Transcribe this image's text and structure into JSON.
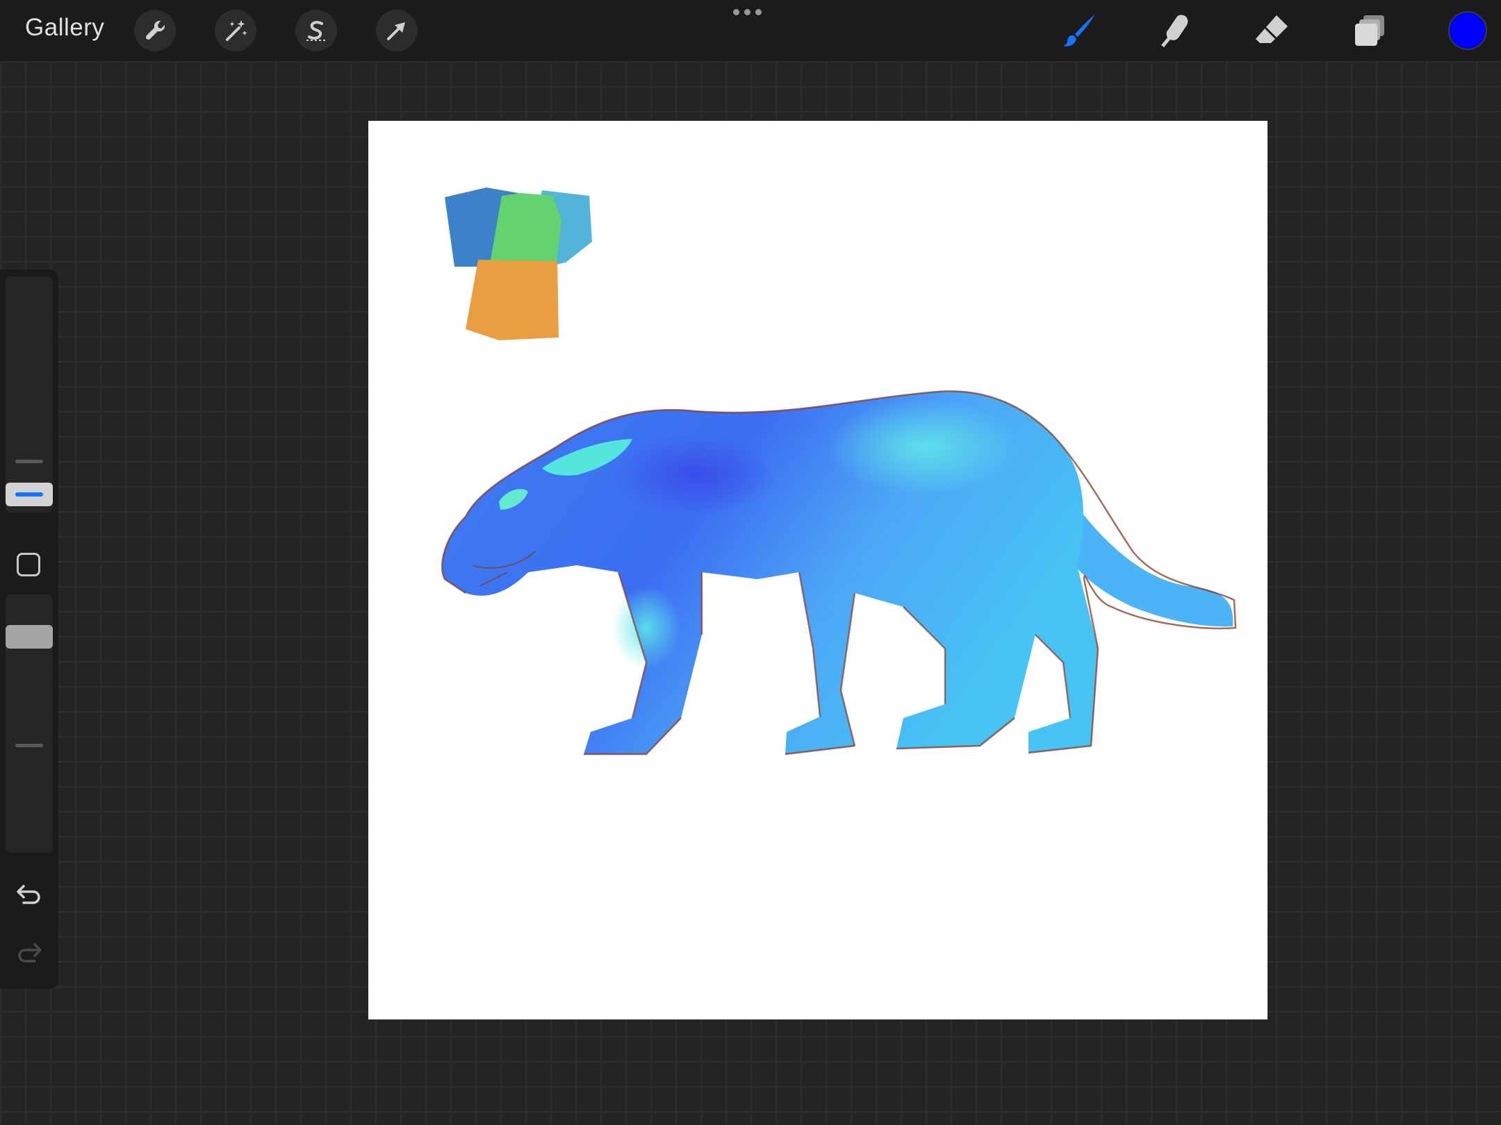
{
  "app": {
    "gallery_label": "Gallery"
  },
  "toolbar_left": [
    {
      "name": "actions",
      "icon": "wrench-icon"
    },
    {
      "name": "adjustments",
      "icon": "magic-wand-icon"
    },
    {
      "name": "selection",
      "icon": "selection-s-icon"
    },
    {
      "name": "transform",
      "icon": "arrow-cursor-icon"
    }
  ],
  "toolbar_right": [
    {
      "name": "brush",
      "icon": "brush-icon",
      "active": true
    },
    {
      "name": "smudge",
      "icon": "smudge-finger-icon",
      "active": false
    },
    {
      "name": "eraser",
      "icon": "eraser-icon",
      "active": false
    },
    {
      "name": "layers",
      "icon": "layers-icon",
      "active": false
    }
  ],
  "current_color": "#0000ff",
  "accent_color": "#1476ff",
  "sidebar": {
    "brush_size_level": 0.2,
    "opacity_level": 0.55,
    "undo_icon": "undo-arrow-icon",
    "redo_icon": "redo-arrow-icon",
    "redo_enabled": false
  },
  "canvas": {
    "background": "#ffffff",
    "palette_swatches": [
      "#3c82c8",
      "#62d36e",
      "#52b4d8",
      "#e99e42"
    ],
    "artwork": "blue-panther-sketch"
  }
}
